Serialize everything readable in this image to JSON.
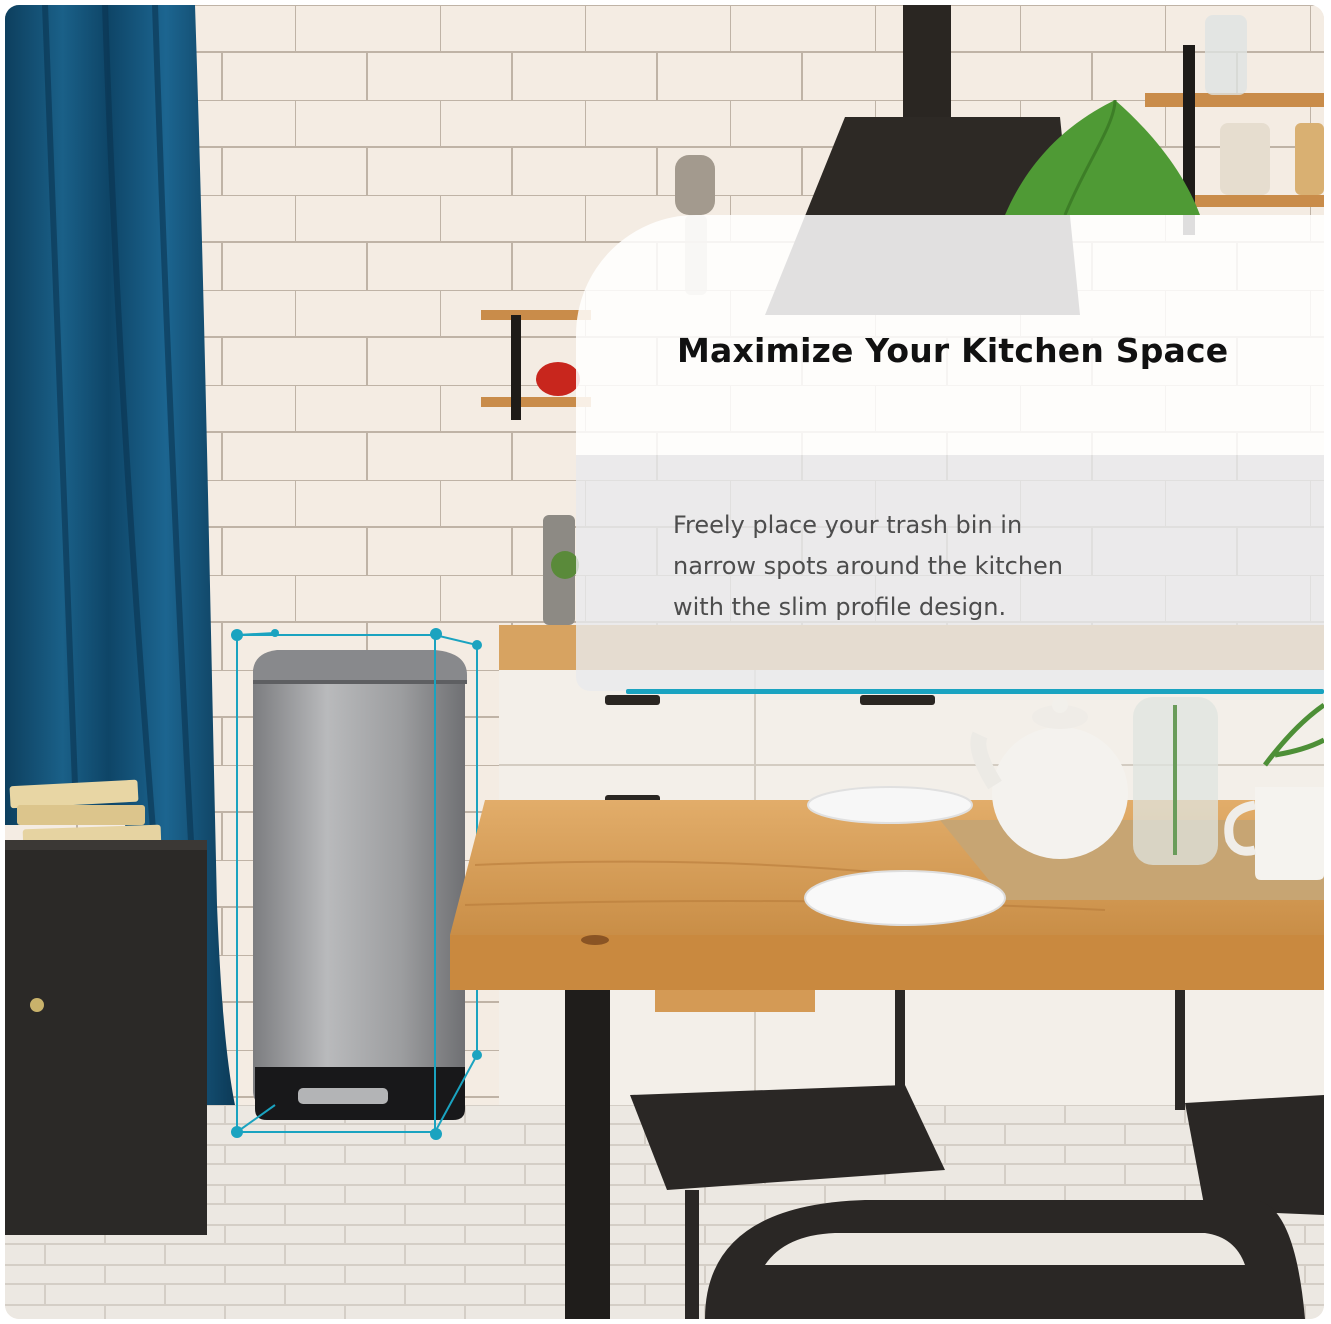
{
  "panel": {
    "headline": "Maximize Your Kitchen Space",
    "description": "Freely place your trash bin in\nnarrow spots around the kitchen\nwith the slim profile design."
  },
  "colors": {
    "accent": "#1aa3c0",
    "curtain": "#104d70",
    "wall_tile": "#f3ebe2",
    "table_wood": "#d9a25e",
    "bin_steel": "#9a9a9c"
  },
  "scene_objects": [
    "blue-curtain",
    "tiled-wall",
    "trash-bin",
    "dimension-outline",
    "wooden-table",
    "black-chairs",
    "teapot",
    "plates",
    "glass-vase",
    "books",
    "black-cabinet",
    "wall-shelves",
    "range-hood",
    "plant-leaf"
  ]
}
